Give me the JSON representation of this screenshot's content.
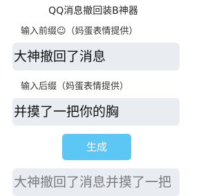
{
  "header": {
    "title": "QQ消息撤回装B神器"
  },
  "form": {
    "prefix_label": "输入前缀☺（妈蛋表情提供）",
    "prefix_value": "大神撤回了消息",
    "suffix_label": "输入后缀（妈蛋表情提供）",
    "suffix_value": "并摸了一把你的胸",
    "generate_label": "生成"
  },
  "output": {
    "value": "大神撤回了消息并摸了一把"
  },
  "colors": {
    "button": "#5cc6f5",
    "field_bg": "#e9ecf0"
  }
}
